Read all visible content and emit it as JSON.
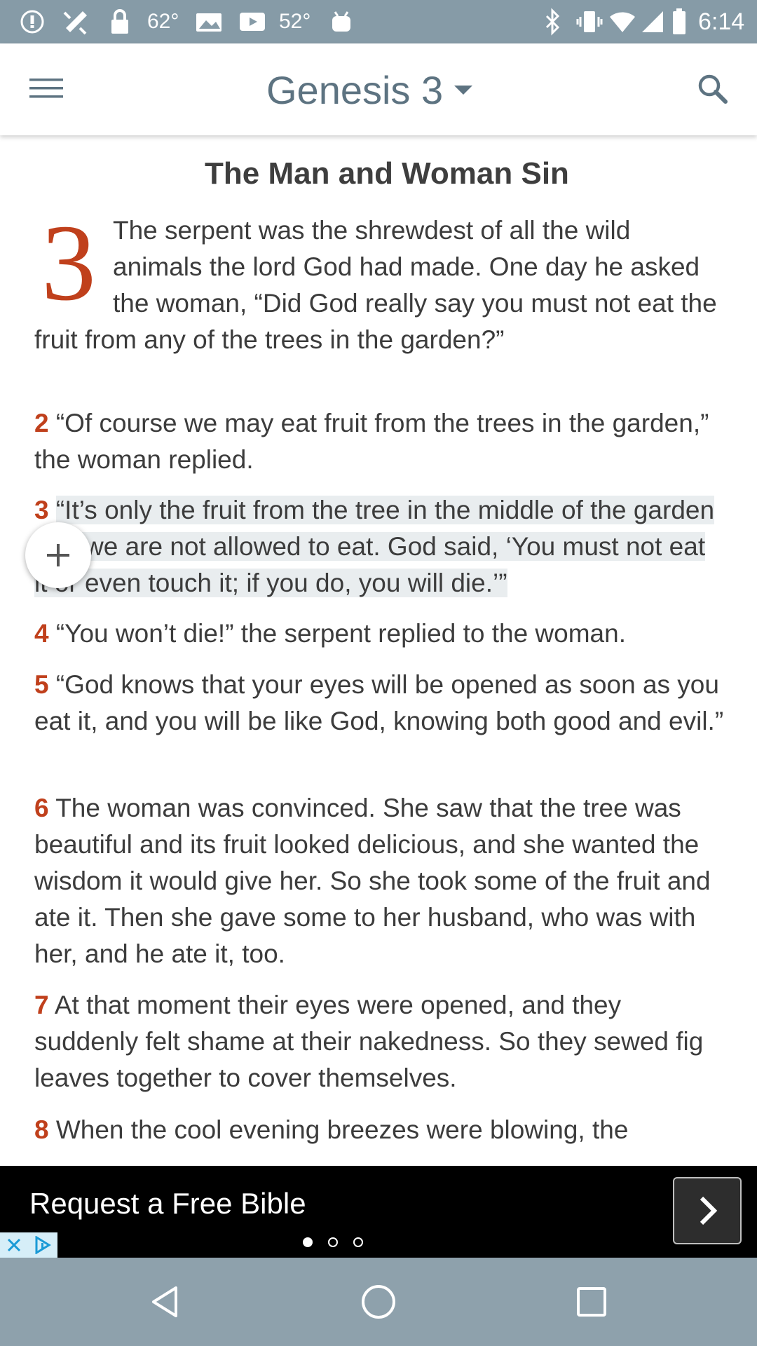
{
  "status_bar": {
    "temp1": "62°",
    "temp2": "52°",
    "time": "6:14",
    "icons": [
      "alert-icon",
      "satellite-icon",
      "lock-icon",
      "image-icon",
      "youtube-icon",
      "android-icon",
      "bluetooth-icon",
      "vibrate-icon",
      "wifi-icon",
      "signal-icon",
      "battery-icon"
    ]
  },
  "app_bar": {
    "title": "Genesis 3",
    "menu_icon": "hamburger-menu-icon",
    "dropdown_icon": "caret-down-icon",
    "search_icon": "search-icon",
    "accent_color": "#5d7381"
  },
  "content": {
    "heading": "The Man and Woman Sin",
    "chapter_number": "3",
    "verse_number_color": "#c0401c",
    "verses": [
      {
        "num": "",
        "text": "The serpent was the shrewdest of all the wild animals the lord God had made. One day he asked the woman, “Did God really say you must not eat the fruit from any of the trees in the garden?”"
      },
      {
        "num": "2",
        "text": "“Of course we may eat fruit from the trees in the garden,” the woman replied."
      },
      {
        "num": "3",
        "text": "“It’s only the fruit from the tree in the middle of the garden that we are not allowed to eat. God said, ‘You must not eat it or even touch it; if you do, you will die.’”"
      },
      {
        "num": "4",
        "text": "“You won’t die!” the serpent replied to the woman."
      },
      {
        "num": "5",
        "text": "“God knows that your eyes will be opened as soon as you eat it, and you will be like God, knowing both good and evil.”"
      },
      {
        "num": "6",
        "text": "The woman was convinced. She saw that the tree was beautiful and its fruit looked delicious, and she wanted the wisdom it would give her. So she took some of the fruit and ate it. Then she gave some to her husband, who was with her, and he ate it, too."
      },
      {
        "num": "7",
        "text": "At that moment their eyes were opened, and they suddenly felt shame at their nakedness. So they sewed fig leaves together to cover themselves."
      },
      {
        "num": "8",
        "text": "When the cool evening breezes were blowing, the"
      }
    ],
    "add_button_icon": "plus-icon"
  },
  "ad": {
    "text": "Request a Free Bible",
    "next_icon": "chevron-right-icon",
    "close_icon": "close-icon",
    "info_icon": "adchoices-icon"
  },
  "nav_bar": {
    "icons": [
      "back-icon",
      "home-icon",
      "recents-icon"
    ]
  }
}
